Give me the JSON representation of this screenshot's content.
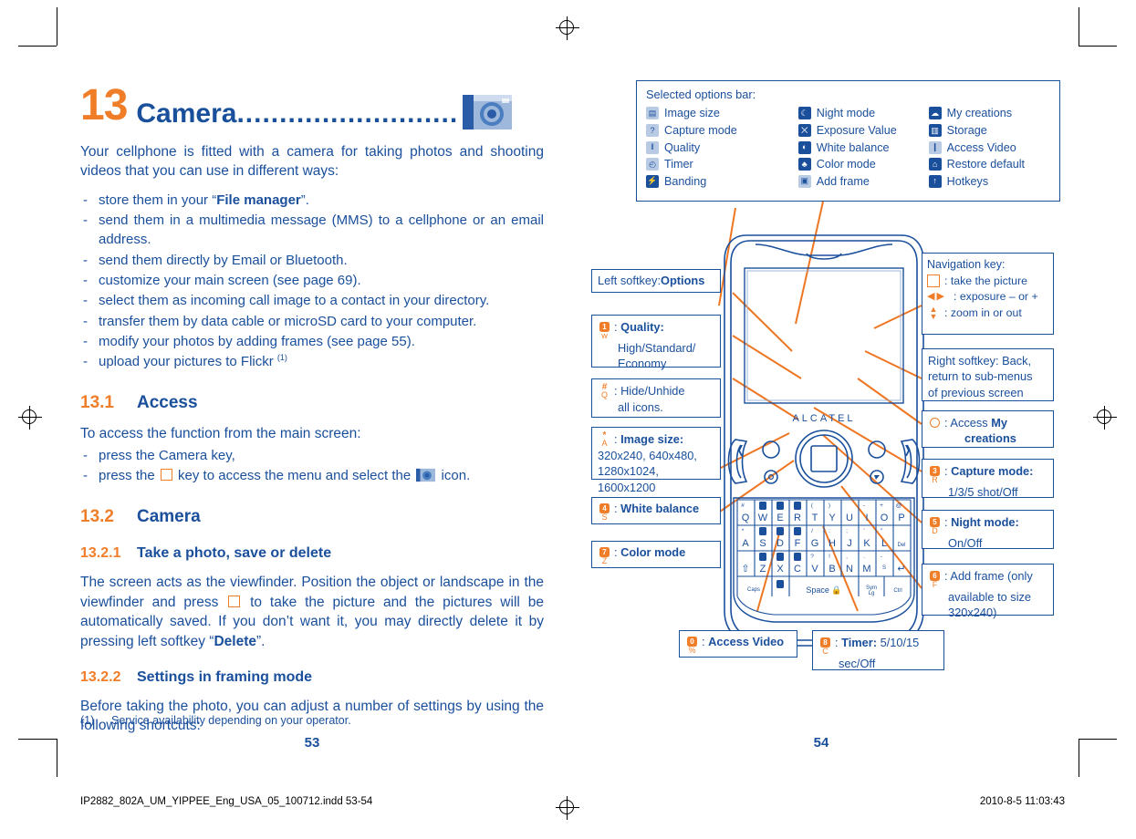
{
  "chapter": {
    "number": "13",
    "title": "Camera",
    "dots": "..........................",
    "intro": "Your cellphone is fitted with a camera for taking photos and shooting videos that you can use in different ways:",
    "bullets": [
      {
        "pre": "store them in your “",
        "bold": "File manager",
        "post": "”."
      },
      {
        "pre": "send them in a multimedia message (MMS) to a cellphone or an email address.",
        "bold": "",
        "post": ""
      },
      {
        "pre": "send them directly by Email or Bluetooth.",
        "bold": "",
        "post": ""
      },
      {
        "pre": "customize your main screen (see page 69).",
        "bold": "",
        "post": ""
      },
      {
        "pre": "select them as incoming call image to a contact in your directory.",
        "bold": "",
        "post": ""
      },
      {
        "pre": "transfer them by data cable or microSD card to your computer.",
        "bold": "",
        "post": ""
      },
      {
        "pre": "modify your photos by adding frames (see page 55).",
        "bold": "",
        "post": ""
      },
      {
        "pre": "upload your pictures to Flickr ",
        "bold": "",
        "post": "(1)"
      }
    ]
  },
  "sections": {
    "access": {
      "number": "13.1",
      "title": "Access",
      "lead": "To access the function from the main screen:",
      "item1": "press the Camera key,",
      "item2a": "press the",
      "item2b": "key to access the menu and select the",
      "item2c": "icon."
    },
    "camera": {
      "number": "13.2",
      "title": "Camera"
    },
    "take_photo": {
      "number": "13.2.1",
      "title": "Take a photo, save or delete",
      "body_a": "The screen acts as the viewfinder. Position the object or landscape in the viewfinder and press",
      "body_b": "to take the picture and the pictures will be automatically saved. If you don’t want it, you may directly delete it by pressing left softkey “",
      "body_bold": "Delete",
      "body_c": "”."
    },
    "framing": {
      "number": "13.2.2",
      "title": "Settings in framing mode",
      "body": "Before taking the photo, you can adjust a number of settings by using the following shortcuts:"
    }
  },
  "footnote": {
    "marker": "(1)",
    "text": "Service availability depending on your operator."
  },
  "page_numbers": {
    "left": "53",
    "right": "54"
  },
  "options_bar": {
    "title": "Selected options bar:",
    "columns": [
      [
        {
          "icon": "image-size-icon",
          "glyph": "▤",
          "label": "Image size",
          "light": true
        },
        {
          "icon": "capture-mode-icon",
          "glyph": "?",
          "label": "Capture mode",
          "light": true
        },
        {
          "icon": "quality-icon",
          "glyph": "‖",
          "label": "Quality",
          "light": true
        },
        {
          "icon": "timer-icon",
          "glyph": "◴",
          "label": "Timer",
          "light": true
        },
        {
          "icon": "banding-icon",
          "glyph": "⚡",
          "label": "Banding",
          "light": false
        }
      ],
      [
        {
          "icon": "night-mode-icon",
          "glyph": "☾",
          "label": "Night mode",
          "light": false
        },
        {
          "icon": "exposure-value-icon",
          "glyph": "⨉",
          "label": "Exposure Value",
          "light": false
        },
        {
          "icon": "white-balance-icon",
          "glyph": "◐",
          "label": "White balance",
          "light": false
        },
        {
          "icon": "color-mode-icon",
          "glyph": "♣",
          "label": "Color mode",
          "light": false
        },
        {
          "icon": "add-frame-icon",
          "glyph": "▣",
          "label": "Add frame",
          "light": true
        }
      ],
      [
        {
          "icon": "my-creations-icon",
          "glyph": "☁",
          "label": "My creations",
          "light": false
        },
        {
          "icon": "storage-icon",
          "glyph": "▥",
          "label": "Storage",
          "light": false
        },
        {
          "icon": "access-video-icon",
          "glyph": "❙",
          "label": "Access Video",
          "light": true
        },
        {
          "icon": "restore-default-icon",
          "glyph": "⌂",
          "label": "Restore default",
          "light": false
        },
        {
          "icon": "hotkeys-icon",
          "glyph": "↑",
          "label": "Hotkeys",
          "light": false
        }
      ]
    ]
  },
  "callouts": {
    "left_softkey": {
      "pre": "Left softkey: ",
      "bold": "Options"
    },
    "quality": {
      "key": "1",
      "letter": "w",
      "bold": "Quality:",
      "lines": [
        "High/Standard/",
        "Economy"
      ]
    },
    "hide": {
      "key": "#",
      "letter": "Q",
      "text": ": Hide/Unhide",
      "line2": "all icons."
    },
    "image_size": {
      "key": "*",
      "letter": "A",
      "bold": "Image size:",
      "lines": [
        "320x240, 640x480,",
        "1280x1024, 1600x1200"
      ]
    },
    "white_balance": {
      "key": "4",
      "letter": "S",
      "bold": "White balance"
    },
    "color_mode": {
      "key": "7",
      "letter": "Z",
      "bold": "Color mode"
    },
    "access_video": {
      "key": "0",
      "letter": "%",
      "bold": "Access Video"
    },
    "timer": {
      "key": "8",
      "letter": "C",
      "bold": "Timer:",
      "rest": " 5/10/15",
      "line2": "sec/Off"
    },
    "navigation": {
      "title": "Navigation key:",
      "take_picture": ": take the picture",
      "exposure": ": exposure – or +",
      "zoom": ": zoom in or out"
    },
    "right_softkey": [
      "Right softkey: Back,",
      "return to sub-menus",
      "of previous screen"
    ],
    "my_creations": {
      "pre": ": Access ",
      "bold": "My",
      "line2": "creations"
    },
    "capture_mode": {
      "key": "3",
      "letter": "R",
      "bold": "Capture mode:",
      "line2": "1/3/5 shot/Off"
    },
    "night_mode": {
      "key": "5",
      "letter": "D",
      "bold": "Night mode:",
      "line2": "On/Off"
    },
    "add_frame": {
      "key": "6",
      "letter": "F",
      "lines": [
        ": Add frame (only",
        "available to size",
        "320x240)"
      ]
    }
  },
  "phone": {
    "brand": "ALCATEL",
    "keyboard": {
      "row1_sym": [
        "#",
        "",
        "",
        "",
        "(",
        ")",
        "-",
        "-",
        "+",
        "@"
      ],
      "row1": [
        "Q",
        "W",
        "E",
        "R",
        "T",
        "Y",
        "U",
        "I",
        "O",
        "P"
      ],
      "row2_sym": [
        "*",
        "",
        "",
        "",
        "/",
        ":",
        ";",
        "'",
        "\"",
        ""
      ],
      "row2": [
        "A",
        "S",
        "D",
        "F",
        "G",
        "H",
        "J",
        "K",
        "L",
        "Del"
      ],
      "row3_sym": [
        "",
        "",
        "",
        "",
        "?",
        "!",
        ",",
        ".",
        "-",
        "$"
      ],
      "row3": [
        "⇧",
        "Z",
        "X",
        "C",
        "V",
        "B",
        "N",
        "M",
        "",
        "↵"
      ],
      "row4": [
        "Caps",
        "",
        "Space",
        "Sym Lg",
        "Ctrl"
      ]
    }
  },
  "footer": {
    "file": "IP2882_802A_UM_YIPPEE_Eng_USA_05_100712.indd   53-54",
    "date": "2010-8-5   11:03:43"
  },
  "colors": {
    "blue": "#1a4f9c",
    "orange": "#f07d28",
    "line": "#ee7623"
  }
}
